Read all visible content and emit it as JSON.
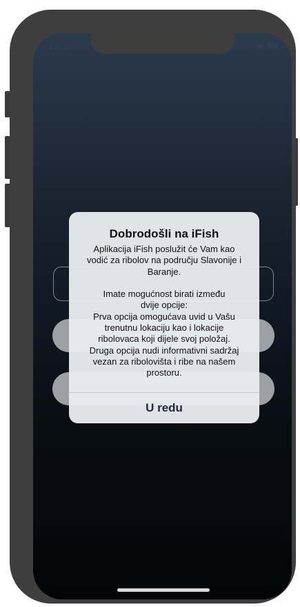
{
  "status_bar": {
    "time": "12:36"
  },
  "alert": {
    "title": "Dobrodošli na iFish",
    "message": "Aplikacija iFish poslužit će Vam kao\nvodić za ribolov na području Slavonije i\nBaranje.\n\nImate mogućnost birati između\ndvije opcije:\nPrva opcija omogućava uvid u Vašu\ntrenutnu lokaciju kao i lokacije\nribolovaca koji dijele svoj položaj.\nDruga opcija nudi informativni sadržaj\nvezan za ribolovišta i ribe na našem\nprostoru.",
    "ok_button_label": "U redu"
  },
  "colors": {
    "screen_top": "#2b3a4d",
    "screen_bottom": "#030507",
    "alert_background": "#e9ebef",
    "alert_button_text": "#1c2a3a"
  },
  "icons": [
    "wifi-icon",
    "battery-icon"
  ]
}
